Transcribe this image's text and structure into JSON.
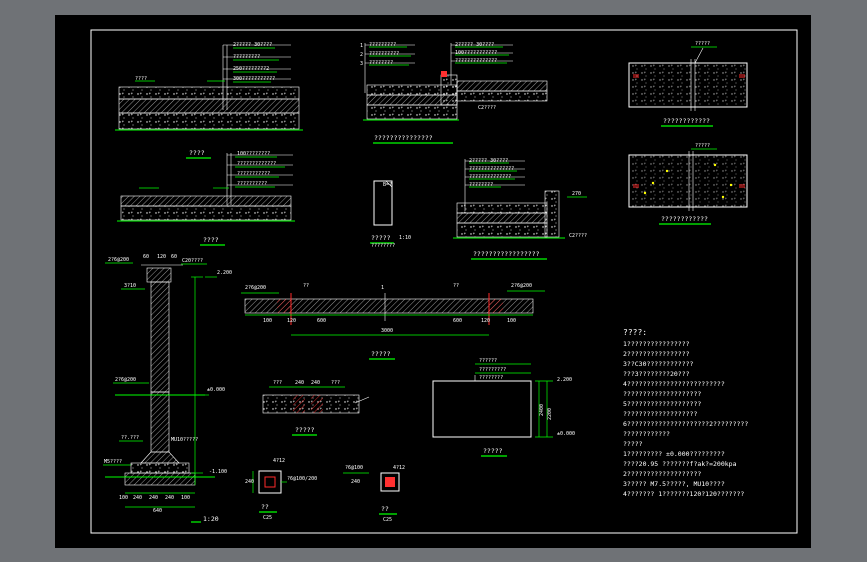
{
  "details": {
    "plan_a": {
      "layers": [
        "2????? 30????",
        "?????????",
        "250????????2",
        "300???????????"
      ],
      "caption": "????"
    },
    "plan_b": {
      "layers": [
        "100????????",
        "?????????????",
        "???????????",
        "??????????"
      ],
      "caption": "????"
    },
    "curb_detail": {
      "layers": [
        "?????????",
        "??????????",
        "????????"
      ],
      "right_layers": [
        "2????? 30????",
        "100???????????",
        "??????????????"
      ],
      "marks": [
        "1",
        "2",
        "3"
      ],
      "label": "C2????",
      "caption": "???????????????"
    },
    "curb_small": {
      "label": "B=?",
      "caption": "?????",
      "scale": "1:10",
      "sub": "????????"
    },
    "curb_detail2": {
      "layers": [
        "2????? 30????",
        "???????????????",
        "??????????????",
        "????????"
      ],
      "dim": "270",
      "label": "C2????",
      "caption": "?????????????????"
    },
    "slab_a": {
      "title": "?????",
      "caption": "????????????"
    },
    "slab_b": {
      "title": "?????",
      "caption": "????????????"
    },
    "wall": {
      "labels": [
        "2?6@200",
        "C20????",
        "3?10",
        "2?6@200",
        "??.???",
        "MU10?????",
        "M5????"
      ],
      "levels": [
        "2.200",
        "±0.000",
        "-1.100"
      ],
      "dims": [
        "60",
        "120",
        "60",
        "100",
        "240",
        "240",
        "240",
        "100",
        "640"
      ],
      "scale": "1:20"
    },
    "beam": {
      "labels": [
        "2?6@200",
        "??",
        "??",
        "2?6@200",
        "???"
      ],
      "dims": [
        "100",
        "120",
        "600",
        "3000",
        "600",
        "120",
        "100"
      ],
      "caption": "?????"
    },
    "section_small": {
      "dims": [
        "???",
        "240",
        "240",
        "???"
      ],
      "caption": "?????"
    },
    "pier": {
      "labels": [
        "??????",
        "?????????",
        "????????"
      ],
      "levels": [
        "2.200",
        "±0.000"
      ],
      "dims": [
        "2400",
        "2200"
      ],
      "caption": "?????"
    },
    "post_a": {
      "labels": [
        "4?12",
        "?6@100/200"
      ],
      "dim": "240",
      "caption": "??",
      "sub": "C25"
    },
    "post_b": {
      "labels": [
        "4?12",
        "?6@100"
      ],
      "dim": "240",
      "caption": "??",
      "sub": "C25"
    }
  },
  "notes": {
    "title": "????:",
    "lines": [
      "1????????????????",
      "2????????????????",
      "3??C30????????????",
      "  ???3????????20???",
      "4?????????????????????????",
      "  ????????????????????",
      "5???????????????????",
      "  ???????????????????",
      "6?????????????????????2?????????",
      "  ????????????",
      "?????",
      "1????????? ±0.000?????????",
      "  ????20.95 ???????f?ak?=200kpa",
      "2???????????????????",
      "3????? M7.5?????, MU10????",
      "4??????? 1???????120?120???????"
    ]
  }
}
